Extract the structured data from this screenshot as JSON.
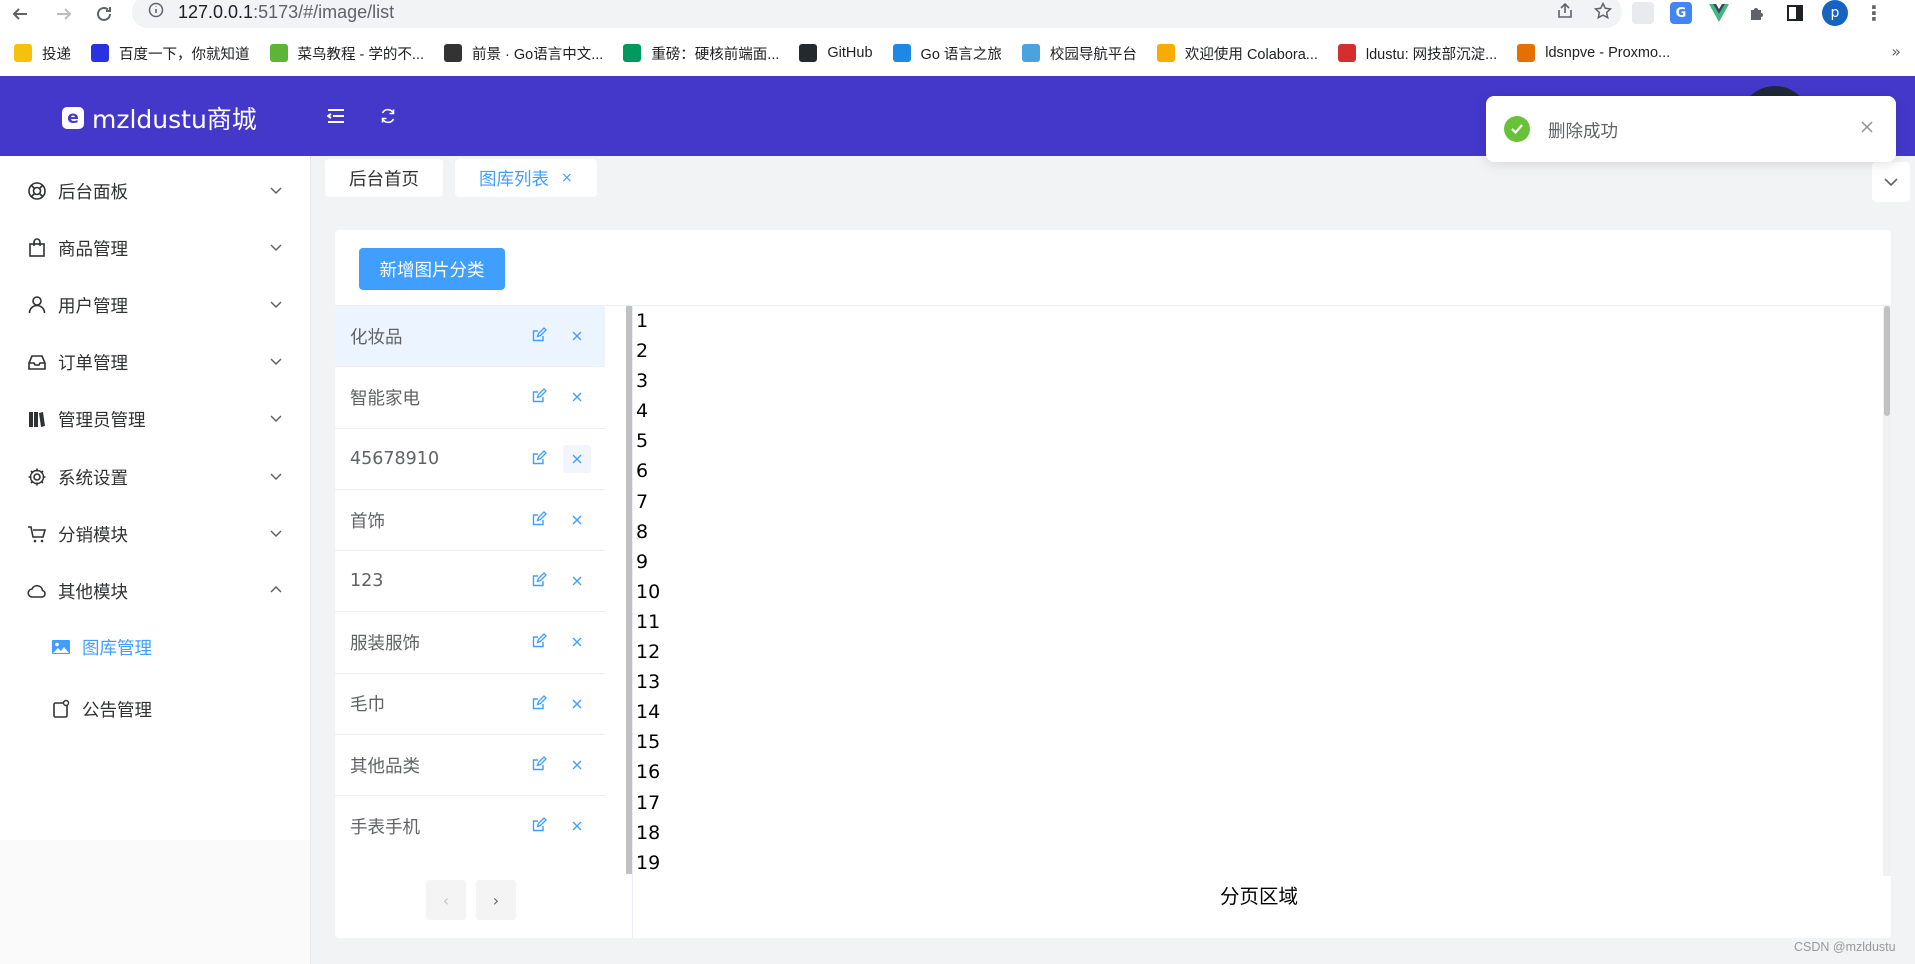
{
  "browser": {
    "url_host": "127.0.0.1",
    "url_rest": ":5173/#/image/list",
    "profile_initial": "p",
    "bookmarks": [
      {
        "label": "投递",
        "color": "#f4c20d"
      },
      {
        "label": "百度一下，你就知道",
        "color": "#2932e1"
      },
      {
        "label": "菜鸟教程 - 学的不...",
        "color": "#5fb336"
      },
      {
        "label": "前景 · Go语言中文...",
        "color": "#333333"
      },
      {
        "label": "重磅：硬核前端面...",
        "color": "#009a61"
      },
      {
        "label": "GitHub",
        "color": "#24292e"
      },
      {
        "label": "Go 语言之旅",
        "color": "#1e88e5"
      },
      {
        "label": "校园导航平台",
        "color": "#4aa3df"
      },
      {
        "label": "欢迎使用 Colabora...",
        "color": "#f9ab00"
      },
      {
        "label": "ldustu: 网技部沉淀...",
        "color": "#d32f2f"
      },
      {
        "label": "ldsnpve - Proxmo...",
        "color": "#e57000"
      }
    ],
    "more": "»"
  },
  "header": {
    "logo_text": "mzldustu商城",
    "logo_mark": "e",
    "avatar_color": "#1f2937"
  },
  "sidebar": {
    "items": [
      {
        "label": "后台面板",
        "icon": "lifebuoy-icon",
        "expanded": false
      },
      {
        "label": "商品管理",
        "icon": "shopping-bag-icon",
        "expanded": false
      },
      {
        "label": "用户管理",
        "icon": "user-icon",
        "expanded": false
      },
      {
        "label": "订单管理",
        "icon": "inbox-icon",
        "expanded": false
      },
      {
        "label": "管理员管理",
        "icon": "notebook-icon",
        "expanded": false
      },
      {
        "label": "系统设置",
        "icon": "gear-icon",
        "expanded": false
      },
      {
        "label": "分销模块",
        "icon": "cart-icon",
        "expanded": false
      },
      {
        "label": "其他模块",
        "icon": "cloud-icon",
        "expanded": true
      }
    ],
    "sub_items": [
      {
        "label": "图库管理",
        "icon": "picture-icon",
        "active": true
      },
      {
        "label": "公告管理",
        "icon": "notice-icon",
        "active": false
      }
    ]
  },
  "tabs": [
    {
      "label": "后台首页",
      "active": false,
      "closable": false
    },
    {
      "label": "图库列表",
      "active": true,
      "closable": true
    }
  ],
  "tab_close_glyph": "×",
  "main": {
    "add_button": "新增图片分类",
    "categories": [
      "化妆品",
      "智能家电",
      "45678910",
      "首饰",
      "123",
      "服装服饰",
      "毛巾",
      "其他品类",
      "手表手机"
    ],
    "active_category_index": 0,
    "numbers": [
      "1",
      "2",
      "3",
      "4",
      "5",
      "6",
      "7",
      "8",
      "9",
      "10",
      "11",
      "12",
      "13",
      "14",
      "15",
      "16",
      "17",
      "18",
      "19"
    ],
    "pagination_label": "分页区域",
    "prev_glyph": "‹",
    "next_glyph": "›"
  },
  "toast": {
    "message": "删除成功",
    "type": "success",
    "color": "#67c23a"
  },
  "watermark": "CSDN @mzldustu",
  "colors": {
    "primary": "#409eff",
    "header_bg": "#4338ca"
  }
}
